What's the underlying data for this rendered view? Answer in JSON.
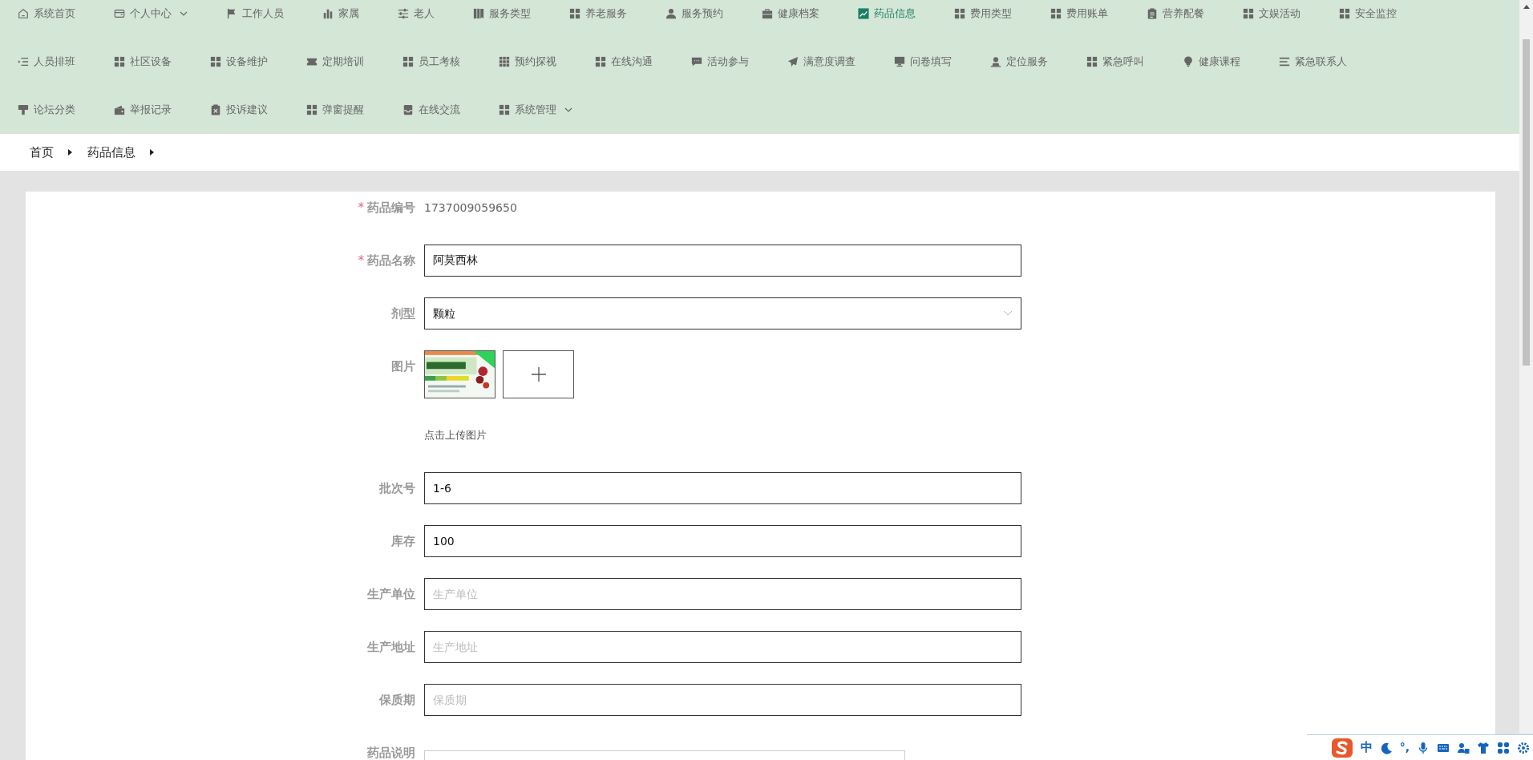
{
  "nav": {
    "rows": [
      [
        {
          "label": "系统首页",
          "selected": false,
          "dropdown": false
        },
        {
          "label": "个人中心",
          "selected": false,
          "dropdown": true
        },
        {
          "label": "工作人员",
          "selected": false,
          "dropdown": false
        },
        {
          "label": "家属",
          "selected": false,
          "dropdown": false
        },
        {
          "label": "老人",
          "selected": false,
          "dropdown": false
        },
        {
          "label": "服务类型",
          "selected": false,
          "dropdown": false
        },
        {
          "label": "养老服务",
          "selected": false,
          "dropdown": false
        },
        {
          "label": "服务预约",
          "selected": false,
          "dropdown": false
        },
        {
          "label": "健康档案",
          "selected": false,
          "dropdown": false
        },
        {
          "label": "药品信息",
          "selected": true,
          "dropdown": false
        },
        {
          "label": "费用类型",
          "selected": false,
          "dropdown": false
        },
        {
          "label": "费用账单",
          "selected": false,
          "dropdown": false
        },
        {
          "label": "营养配餐",
          "selected": false,
          "dropdown": false
        },
        {
          "label": "文娱活动",
          "selected": false,
          "dropdown": false
        },
        {
          "label": "安全监控",
          "selected": false,
          "dropdown": false
        }
      ],
      [
        {
          "label": "人员排班",
          "selected": false,
          "dropdown": false
        },
        {
          "label": "社区设备",
          "selected": false,
          "dropdown": false
        },
        {
          "label": "设备维护",
          "selected": false,
          "dropdown": false
        },
        {
          "label": "定期培训",
          "selected": false,
          "dropdown": false
        },
        {
          "label": "员工考核",
          "selected": false,
          "dropdown": false
        },
        {
          "label": "预约探视",
          "selected": false,
          "dropdown": false
        },
        {
          "label": "在线沟通",
          "selected": false,
          "dropdown": false
        },
        {
          "label": "活动参与",
          "selected": false,
          "dropdown": false
        },
        {
          "label": "满意度调查",
          "selected": false,
          "dropdown": false
        },
        {
          "label": "问卷填写",
          "selected": false,
          "dropdown": false
        },
        {
          "label": "定位服务",
          "selected": false,
          "dropdown": false
        },
        {
          "label": "紧急呼叫",
          "selected": false,
          "dropdown": false
        },
        {
          "label": "健康课程",
          "selected": false,
          "dropdown": false
        },
        {
          "label": "紧急联系人",
          "selected": false,
          "dropdown": false
        }
      ],
      [
        {
          "label": "论坛分类",
          "selected": false,
          "dropdown": false
        },
        {
          "label": "举报记录",
          "selected": false,
          "dropdown": false
        },
        {
          "label": "投诉建议",
          "selected": false,
          "dropdown": false
        },
        {
          "label": "弹窗提醒",
          "selected": false,
          "dropdown": false
        },
        {
          "label": "在线交流",
          "selected": false,
          "dropdown": false
        },
        {
          "label": "系统管理",
          "selected": false,
          "dropdown": true
        }
      ]
    ]
  },
  "breadcrumb": [
    "首页",
    "药品信息"
  ],
  "form": {
    "fields": [
      {
        "kind": "static",
        "label": "药品编号",
        "required_mark": "*",
        "value": "1737009059650"
      },
      {
        "kind": "input",
        "label": "药品名称",
        "required_mark": "*",
        "value": "阿莫西林"
      },
      {
        "kind": "select",
        "label": "剂型",
        "value": "颗粒"
      },
      {
        "label": "图片",
        "hint": "点击上传图片"
      },
      {
        "kind": "input",
        "label": "批次号",
        "value": "1-6"
      },
      {
        "kind": "input",
        "label": "库存",
        "value": "100"
      },
      {
        "kind": "input",
        "label": "生产单位",
        "placeholder": "生产单位"
      },
      {
        "kind": "input",
        "label": "生产地址",
        "placeholder": "生产地址"
      },
      {
        "kind": "input",
        "label": "保质期",
        "placeholder": "保质期"
      },
      {
        "kind": "textarea",
        "label": "药品说明"
      }
    ]
  },
  "ime_toolbar": {
    "mode": "中",
    "punctuation": "°,"
  }
}
